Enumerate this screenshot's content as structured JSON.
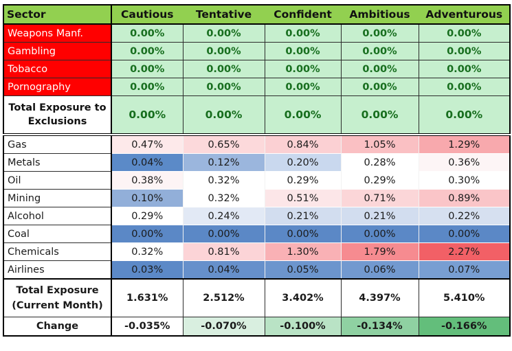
{
  "table": {
    "header": {
      "sector_label": "Sector",
      "columns": [
        "Cautious",
        "Tentative",
        "Confident",
        "Ambitious",
        "Adventurous"
      ]
    },
    "exclusions": [
      {
        "sector": "Weapons Manf.",
        "values": [
          "0.00%",
          "0.00%",
          "0.00%",
          "0.00%",
          "0.00%"
        ]
      },
      {
        "sector": "Gambling",
        "values": [
          "0.00%",
          "0.00%",
          "0.00%",
          "0.00%",
          "0.00%"
        ]
      },
      {
        "sector": "Tobacco",
        "values": [
          "0.00%",
          "0.00%",
          "0.00%",
          "0.00%",
          "0.00%"
        ]
      },
      {
        "sector": "Pornography",
        "values": [
          "0.00%",
          "0.00%",
          "0.00%",
          "0.00%",
          "0.00%"
        ]
      }
    ],
    "exclusions_total": {
      "label_line1": "Total Exposure to",
      "label_line2": "Exclusions",
      "values": [
        "0.00%",
        "0.00%",
        "0.00%",
        "0.00%",
        "0.00%"
      ]
    },
    "sectors": [
      {
        "sector": "Gas",
        "values": [
          "0.47%",
          "0.65%",
          "0.84%",
          "1.05%",
          "1.29%"
        ],
        "colors": [
          "#fde9ea",
          "#fcd9db",
          "#fbd0d3",
          "#fac0c3",
          "#f8a9ad"
        ]
      },
      {
        "sector": "Metals",
        "values": [
          "0.04%",
          "0.12%",
          "0.20%",
          "0.28%",
          "0.36%"
        ],
        "colors": [
          "#5b8ac8",
          "#9bb6dd",
          "#c9d8ee",
          "#ffffff",
          "#fdf5f6"
        ]
      },
      {
        "sector": "Oil",
        "values": [
          "0.38%",
          "0.32%",
          "0.29%",
          "0.29%",
          "0.30%"
        ],
        "colors": [
          "#fdf4f5",
          "#ffffff",
          "#ffffff",
          "#ffffff",
          "#ffffff"
        ]
      },
      {
        "sector": "Mining",
        "values": [
          "0.10%",
          "0.32%",
          "0.51%",
          "0.71%",
          "0.89%"
        ],
        "colors": [
          "#92afd9",
          "#ffffff",
          "#fce6e8",
          "#fbd6d8",
          "#fac5c8"
        ]
      },
      {
        "sector": "Alcohol",
        "values": [
          "0.29%",
          "0.24%",
          "0.21%",
          "0.21%",
          "0.22%"
        ],
        "colors": [
          "#ffffff",
          "#e2e9f5",
          "#d2ddef",
          "#d2ddef",
          "#d6e0f0"
        ]
      },
      {
        "sector": "Coal",
        "values": [
          "0.00%",
          "0.00%",
          "0.00%",
          "0.00%",
          "0.00%"
        ],
        "colors": [
          "#5b88c6",
          "#5b88c6",
          "#5b88c6",
          "#5b88c6",
          "#5b88c6"
        ]
      },
      {
        "sector": "Chemicals",
        "values": [
          "0.32%",
          "0.81%",
          "1.30%",
          "1.79%",
          "2.27%"
        ],
        "colors": [
          "#ffffff",
          "#fcd4d7",
          "#f9b1b5",
          "#f68b90",
          "#f26066"
        ]
      },
      {
        "sector": "Airlines",
        "values": [
          "0.03%",
          "0.04%",
          "0.05%",
          "0.06%",
          "0.07%"
        ],
        "colors": [
          "#5c89c7",
          "#6690cb",
          "#6c95cd",
          "#7299cf",
          "#789ed2"
        ]
      }
    ],
    "total_exposure": {
      "label_line1": "Total Exposure",
      "label_line2": "(Current Month)",
      "values": [
        "1.631%",
        "2.512%",
        "3.402%",
        "4.397%",
        "5.410%"
      ]
    },
    "change": {
      "label": "Change",
      "values": [
        "-0.035%",
        "-0.070%",
        "-0.100%",
        "-0.134%",
        "-0.166%"
      ],
      "colors": [
        "#ffffff",
        "#d9efe0",
        "#b9e3c5",
        "#8fd1a2",
        "#63be7b"
      ]
    }
  },
  "colors": {
    "header_bg": "#92d050",
    "exclusion_label_bg": "#ff0000",
    "exclusion_value_bg": "#c6efce",
    "exclusion_value_text": "#176e1e"
  }
}
